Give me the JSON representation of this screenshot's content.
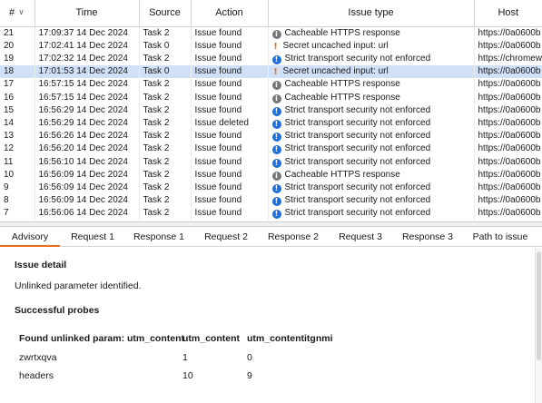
{
  "table": {
    "columns": [
      {
        "key": "num",
        "label": "#"
      },
      {
        "key": "time",
        "label": "Time"
      },
      {
        "key": "source",
        "label": "Source"
      },
      {
        "key": "action",
        "label": "Action"
      },
      {
        "key": "issue_type",
        "label": "Issue type"
      },
      {
        "key": "host",
        "label": "Host"
      }
    ],
    "sort_indicator_icon": "chevron-down-icon",
    "selected_num": "18",
    "rows": [
      {
        "num": "21",
        "time": "17:09:37 14 Dec 2024",
        "source": "Task 2",
        "action": "Issue found",
        "icon": "info",
        "issue_type": "Cacheable HTTPS response",
        "host": "https://0a0600b"
      },
      {
        "num": "20",
        "time": "17:02:41 14 Dec 2024",
        "source": "Task 0",
        "action": "Issue found",
        "icon": "warn",
        "issue_type": "Secret uncached input: url",
        "host": "https://0a0600b"
      },
      {
        "num": "19",
        "time": "17:02:32 14 Dec 2024",
        "source": "Task 2",
        "action": "Issue found",
        "icon": "high",
        "issue_type": "Strict transport security not enforced",
        "host": "https://chromew"
      },
      {
        "num": "18",
        "time": "17:01:53 14 Dec 2024",
        "source": "Task 0",
        "action": "Issue found",
        "icon": "warn",
        "issue_type": "Secret uncached input: url",
        "host": "https://0a0600b"
      },
      {
        "num": "17",
        "time": "16:57:15 14 Dec 2024",
        "source": "Task 2",
        "action": "Issue found",
        "icon": "info",
        "issue_type": "Cacheable HTTPS response",
        "host": "https://0a0600b"
      },
      {
        "num": "16",
        "time": "16:57:15 14 Dec 2024",
        "source": "Task 2",
        "action": "Issue found",
        "icon": "info",
        "issue_type": "Cacheable HTTPS response",
        "host": "https://0a0600b"
      },
      {
        "num": "15",
        "time": "16:56:29 14 Dec 2024",
        "source": "Task 2",
        "action": "Issue found",
        "icon": "high",
        "issue_type": "Strict transport security not enforced",
        "host": "https://0a0600b"
      },
      {
        "num": "14",
        "time": "16:56:29 14 Dec 2024",
        "source": "Task 2",
        "action": "Issue deleted",
        "icon": "high",
        "issue_type": "Strict transport security not enforced",
        "host": "https://0a0600b"
      },
      {
        "num": "13",
        "time": "16:56:26 14 Dec 2024",
        "source": "Task 2",
        "action": "Issue found",
        "icon": "high",
        "issue_type": "Strict transport security not enforced",
        "host": "https://0a0600b"
      },
      {
        "num": "12",
        "time": "16:56:20 14 Dec 2024",
        "source": "Task 2",
        "action": "Issue found",
        "icon": "high",
        "issue_type": "Strict transport security not enforced",
        "host": "https://0a0600b"
      },
      {
        "num": "11",
        "time": "16:56:10 14 Dec 2024",
        "source": "Task 2",
        "action": "Issue found",
        "icon": "high",
        "issue_type": "Strict transport security not enforced",
        "host": "https://0a0600b"
      },
      {
        "num": "10",
        "time": "16:56:09 14 Dec 2024",
        "source": "Task 2",
        "action": "Issue found",
        "icon": "info",
        "issue_type": "Cacheable HTTPS response",
        "host": "https://0a0600b"
      },
      {
        "num": "9",
        "time": "16:56:09 14 Dec 2024",
        "source": "Task 2",
        "action": "Issue found",
        "icon": "high",
        "issue_type": "Strict transport security not enforced",
        "host": "https://0a0600b"
      },
      {
        "num": "8",
        "time": "16:56:09 14 Dec 2024",
        "source": "Task 2",
        "action": "Issue found",
        "icon": "high",
        "issue_type": "Strict transport security not enforced",
        "host": "https://0a0600b"
      },
      {
        "num": "7",
        "time": "16:56:06 14 Dec 2024",
        "source": "Task 2",
        "action": "Issue found",
        "icon": "high",
        "issue_type": "Strict transport security not enforced",
        "host": "https://0a0600b"
      }
    ]
  },
  "tabs": [
    {
      "label": "Advisory",
      "active": true
    },
    {
      "label": "Request 1",
      "active": false
    },
    {
      "label": "Response 1",
      "active": false
    },
    {
      "label": "Request 2",
      "active": false
    },
    {
      "label": "Response 2",
      "active": false
    },
    {
      "label": "Request 3",
      "active": false
    },
    {
      "label": "Response 3",
      "active": false
    },
    {
      "label": "Path to issue",
      "active": false
    }
  ],
  "advisory": {
    "issue_detail_heading": "Issue detail",
    "issue_detail_text": "Unlinked parameter identified.",
    "probes_heading": "Successful probes",
    "probes_table": {
      "headers": [
        "Found unlinked param: utm_content",
        "utm_content",
        "utm_contentitgnmi"
      ],
      "rows": [
        [
          "zwrtxqva",
          "1",
          "0"
        ],
        [
          "headers",
          "10",
          "9"
        ]
      ]
    }
  },
  "colors": {
    "accent_tab_underline": "#e8701a",
    "selected_row": "#cfe0f7",
    "high_severity": "#1e6fd9",
    "info_severity": "#777777",
    "warning_severity": "#e8701a"
  }
}
